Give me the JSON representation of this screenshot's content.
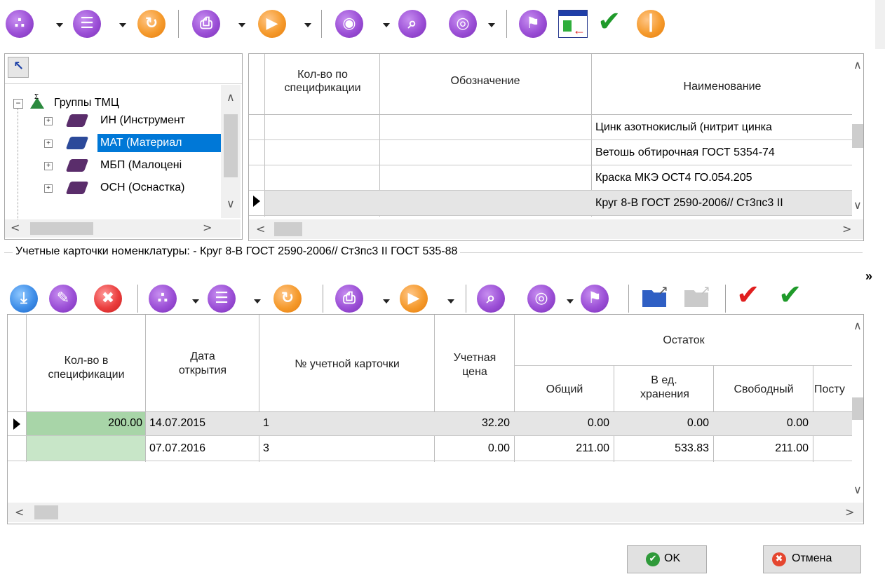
{
  "toolbar_top": {
    "icons": [
      "link-icon",
      "document-icon",
      "refresh-icon",
      "print-icon",
      "play-icon",
      "eye-icon",
      "zoom-icon",
      "globe-icon",
      "flag-icon",
      "import-table-icon",
      "checkmark-icon",
      "columns-icon"
    ]
  },
  "tree": {
    "root_label": "Группы ТМЦ",
    "items": [
      {
        "label": "ИН (Инструмент"
      },
      {
        "label": "МАТ (Материал"
      },
      {
        "label": "МБП (Малоцені"
      },
      {
        "label": "ОСН (Оснастка)"
      }
    ]
  },
  "top_grid": {
    "headers": {
      "qty": "Кол-во по спецификации",
      "designation": "Обозначение",
      "name": "Наименование"
    },
    "rows": [
      {
        "qty": "",
        "designation": "",
        "name": "Цинк азотнокислый (нитрит цинка"
      },
      {
        "qty": "",
        "designation": "",
        "name": "Ветошь обтирочная ГОСТ 5354-74"
      },
      {
        "qty": "",
        "designation": "",
        "name": "Краска МКЭ ОСТ4 ГО.054.205"
      },
      {
        "qty": "",
        "designation": "",
        "name": "Круг 8-В ГОСТ 2590-2006// Ст3пс3 II"
      }
    ]
  },
  "section_title": "Учетные карточки номенклатуры: - Круг 8-В ГОСТ 2590-2006// Ст3пс3 II ГОСТ 535-88",
  "overflow_label": "»",
  "bottom_grid": {
    "headers": {
      "qty_spec": "Кол-во в спецификации",
      "open_date": "Дата открытия",
      "card_no": "№ учетной карточки",
      "price": "Учетная цена",
      "remainder": "Остаток",
      "total": "Общий",
      "storage_units": "В ед. хранения",
      "free": "Свободный",
      "receipt": "Посту"
    },
    "rows": [
      {
        "qty_spec": "200.00",
        "open_date": "14.07.2015",
        "card_no": "1",
        "price": "32.20",
        "total": "0.00",
        "storage_units": "0.00",
        "free": "0.00"
      },
      {
        "qty_spec": "",
        "open_date": "07.07.2016",
        "card_no": "3",
        "price": "0.00",
        "total": "211.00",
        "storage_units": "533.83",
        "free": "211.00"
      }
    ]
  },
  "buttons": {
    "ok": "OK",
    "cancel": "Отмена"
  }
}
